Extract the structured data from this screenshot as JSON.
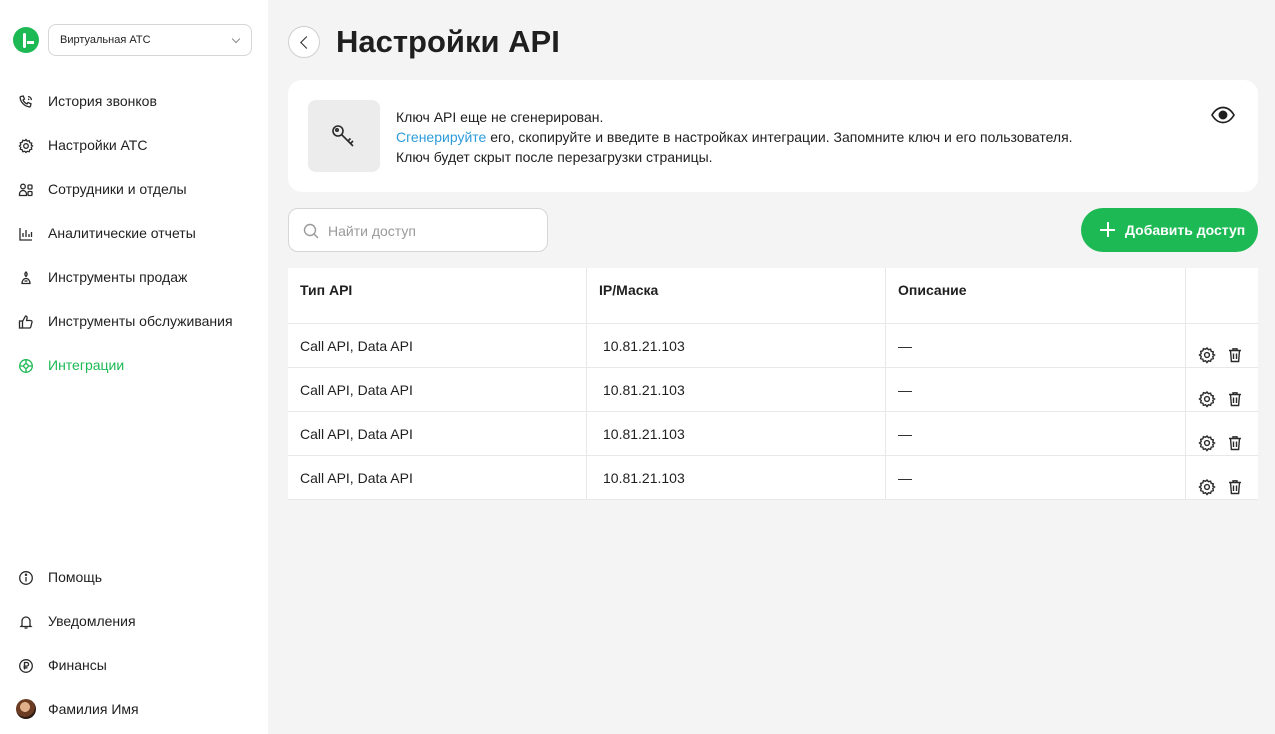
{
  "sidebar": {
    "ats_select": {
      "value": "Виртуальная АТС"
    },
    "nav": [
      {
        "label": "История звонков",
        "icon": "phone-history-icon"
      },
      {
        "label": "Настройки АТС",
        "icon": "gear-icon"
      },
      {
        "label": "Сотрудники и отделы",
        "icon": "people-icon"
      },
      {
        "label": "Аналитические отчеты",
        "icon": "bar-chart-icon"
      },
      {
        "label": "Инструменты продаж",
        "icon": "sales-tools-icon"
      },
      {
        "label": "Инструменты обслуживания",
        "icon": "thumbs-up-icon"
      },
      {
        "label": "Интеграции",
        "icon": "integrations-icon",
        "active": true
      }
    ],
    "bottom": [
      {
        "label": "Помощь",
        "icon": "info-icon"
      },
      {
        "label": "Уведомления",
        "icon": "bell-icon"
      },
      {
        "label": "Финансы",
        "icon": "ruble-icon"
      },
      {
        "label": "Фамилия Имя",
        "icon": "avatar"
      }
    ]
  },
  "header": {
    "title": "Настройки API"
  },
  "info": {
    "line1": "Ключ API еще не сгенерирован.",
    "link": "Сгенерируйте",
    "line2_rest": " его, скопируйте и введите в настройках интеграции. Запомните ключ и его пользователя.",
    "line3": "Ключ будет скрыт после перезагрузки страницы."
  },
  "search": {
    "placeholder": "Найти доступ",
    "value": ""
  },
  "add_button": {
    "label": "Добавить доступ"
  },
  "table": {
    "columns": [
      "Тип API",
      "IP/Маска",
      "Описание",
      ""
    ],
    "rows": [
      {
        "type": "Call API, Data API",
        "ip": "10.81.21.103",
        "description": "—"
      },
      {
        "type": "Call API, Data API",
        "ip": "10.81.21.103",
        "description": "—"
      },
      {
        "type": "Call API, Data API",
        "ip": "10.81.21.103",
        "description": "—"
      },
      {
        "type": "Call API, Data API",
        "ip": "10.81.21.103",
        "description": "—"
      }
    ]
  },
  "colors": {
    "accent": "#1db954",
    "link": "#2d9cdb",
    "background": "#f4f4f4"
  }
}
